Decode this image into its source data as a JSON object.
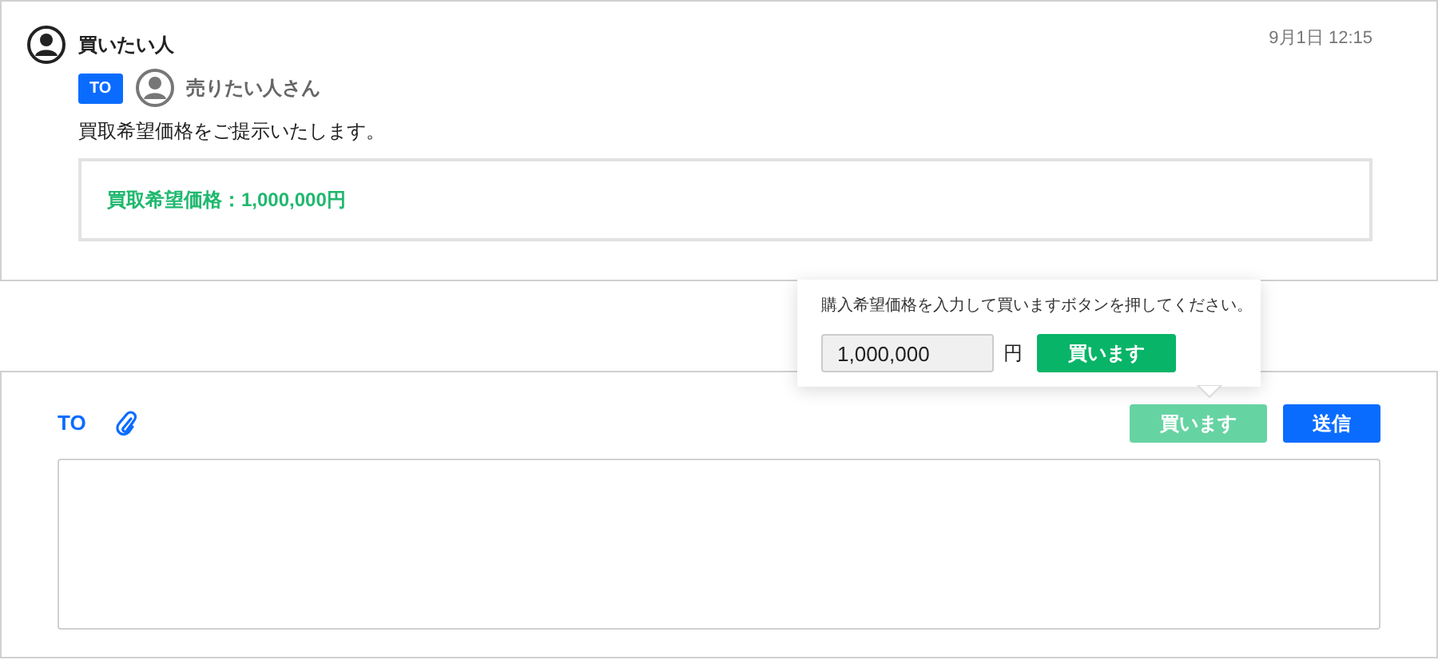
{
  "message": {
    "sender": "買いたい人",
    "time": "9月1日 12:15",
    "to_badge": "TO",
    "recipient": "売りたい人さん",
    "body": "買取希望価格をご提示いたします。",
    "offer": "買取希望価格：1,000,000円"
  },
  "popover": {
    "instruction": "購入希望価格を入力して買いますボタンを押してください。",
    "price_value": "1,000,000",
    "unit": "円",
    "buy_button": "買います"
  },
  "composer": {
    "to_label": "TO",
    "buy_button": {
      "label": "買います",
      "disabled": true
    },
    "send_button": "送信"
  }
}
